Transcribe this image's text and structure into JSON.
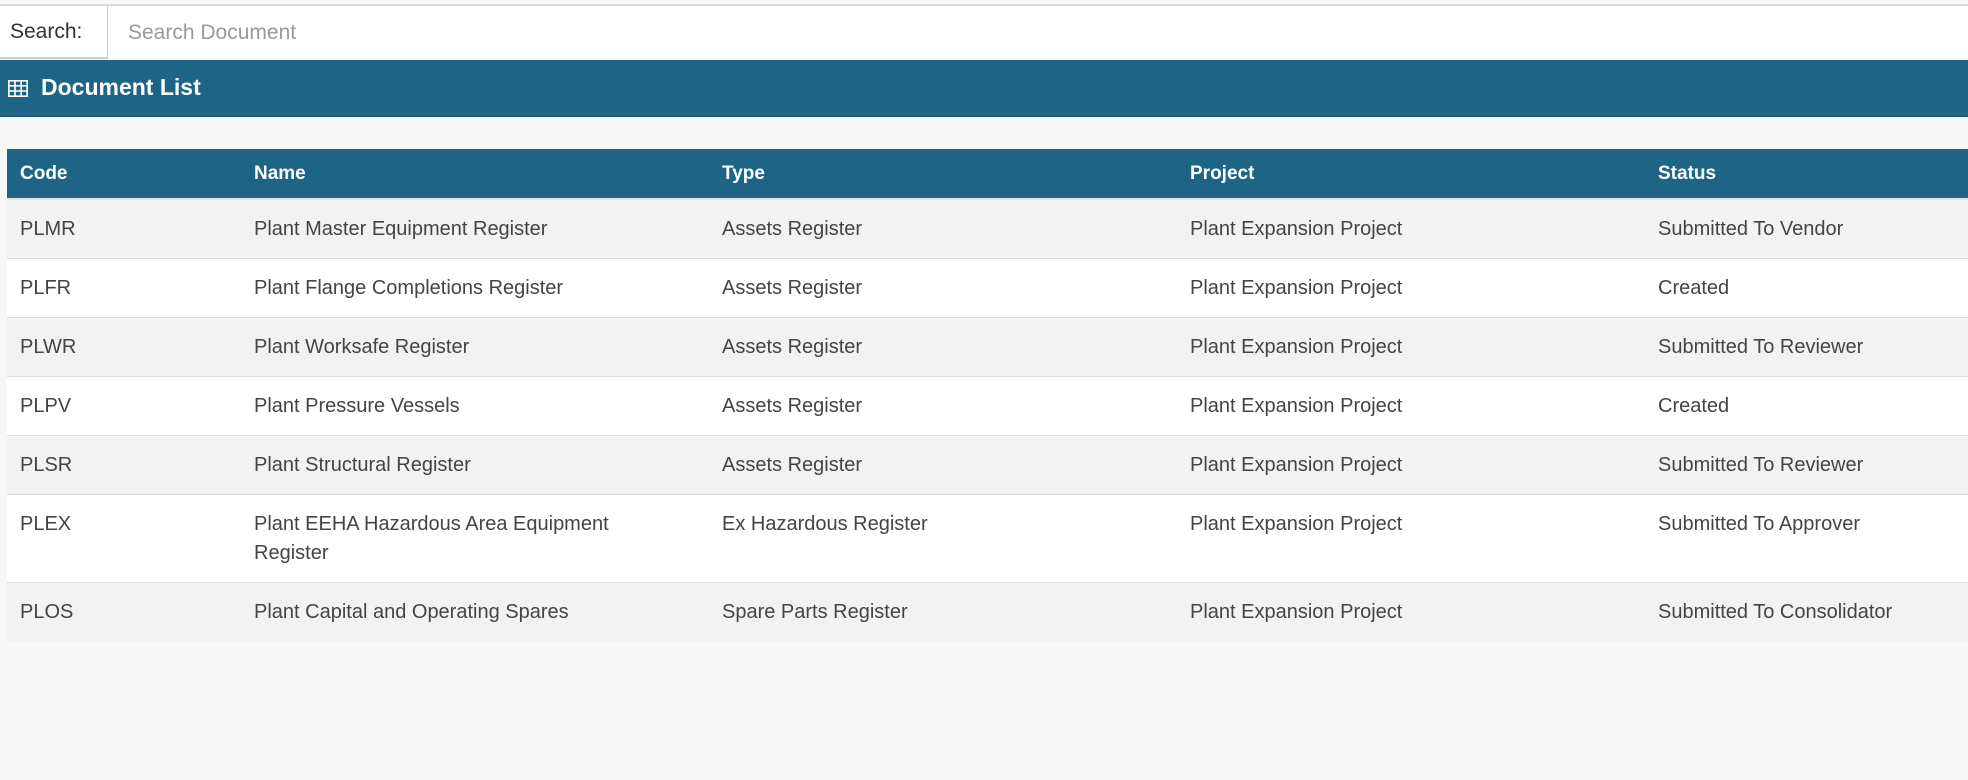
{
  "search": {
    "label": "Search:",
    "placeholder": "Search Document",
    "value": ""
  },
  "panel": {
    "icon": "table-icon",
    "title": "Document List"
  },
  "table": {
    "columns": [
      "Code",
      "Name",
      "Type",
      "Project",
      "Status"
    ],
    "rows": [
      {
        "code": "PLMR",
        "name": "Plant Master Equipment Register",
        "type": "Assets Register",
        "project": "Plant Expansion Project",
        "status": "Submitted To Vendor"
      },
      {
        "code": "PLFR",
        "name": "Plant Flange Completions Register",
        "type": "Assets Register",
        "project": "Plant Expansion Project",
        "status": "Created"
      },
      {
        "code": "PLWR",
        "name": "Plant Worksafe Register",
        "type": "Assets Register",
        "project": "Plant Expansion Project",
        "status": "Submitted To Reviewer"
      },
      {
        "code": "PLPV",
        "name": "Plant Pressure Vessels",
        "type": "Assets Register",
        "project": "Plant Expansion Project",
        "status": "Created"
      },
      {
        "code": "PLSR",
        "name": "Plant Structural Register",
        "type": "Assets Register",
        "project": "Plant Expansion Project",
        "status": "Submitted To Reviewer"
      },
      {
        "code": "PLEX",
        "name": "Plant EEHA Hazardous Area Equipment Register",
        "type": "Ex Hazardous Register",
        "project": "Plant Expansion Project",
        "status": "Submitted To Approver"
      },
      {
        "code": "PLOS",
        "name": "Plant Capital and Operating Spares",
        "type": "Spare Parts Register",
        "project": "Plant Expansion Project",
        "status": "Submitted To Consolidator"
      }
    ]
  },
  "colors": {
    "header": "#1e6585",
    "background": "#f7f7f7"
  }
}
